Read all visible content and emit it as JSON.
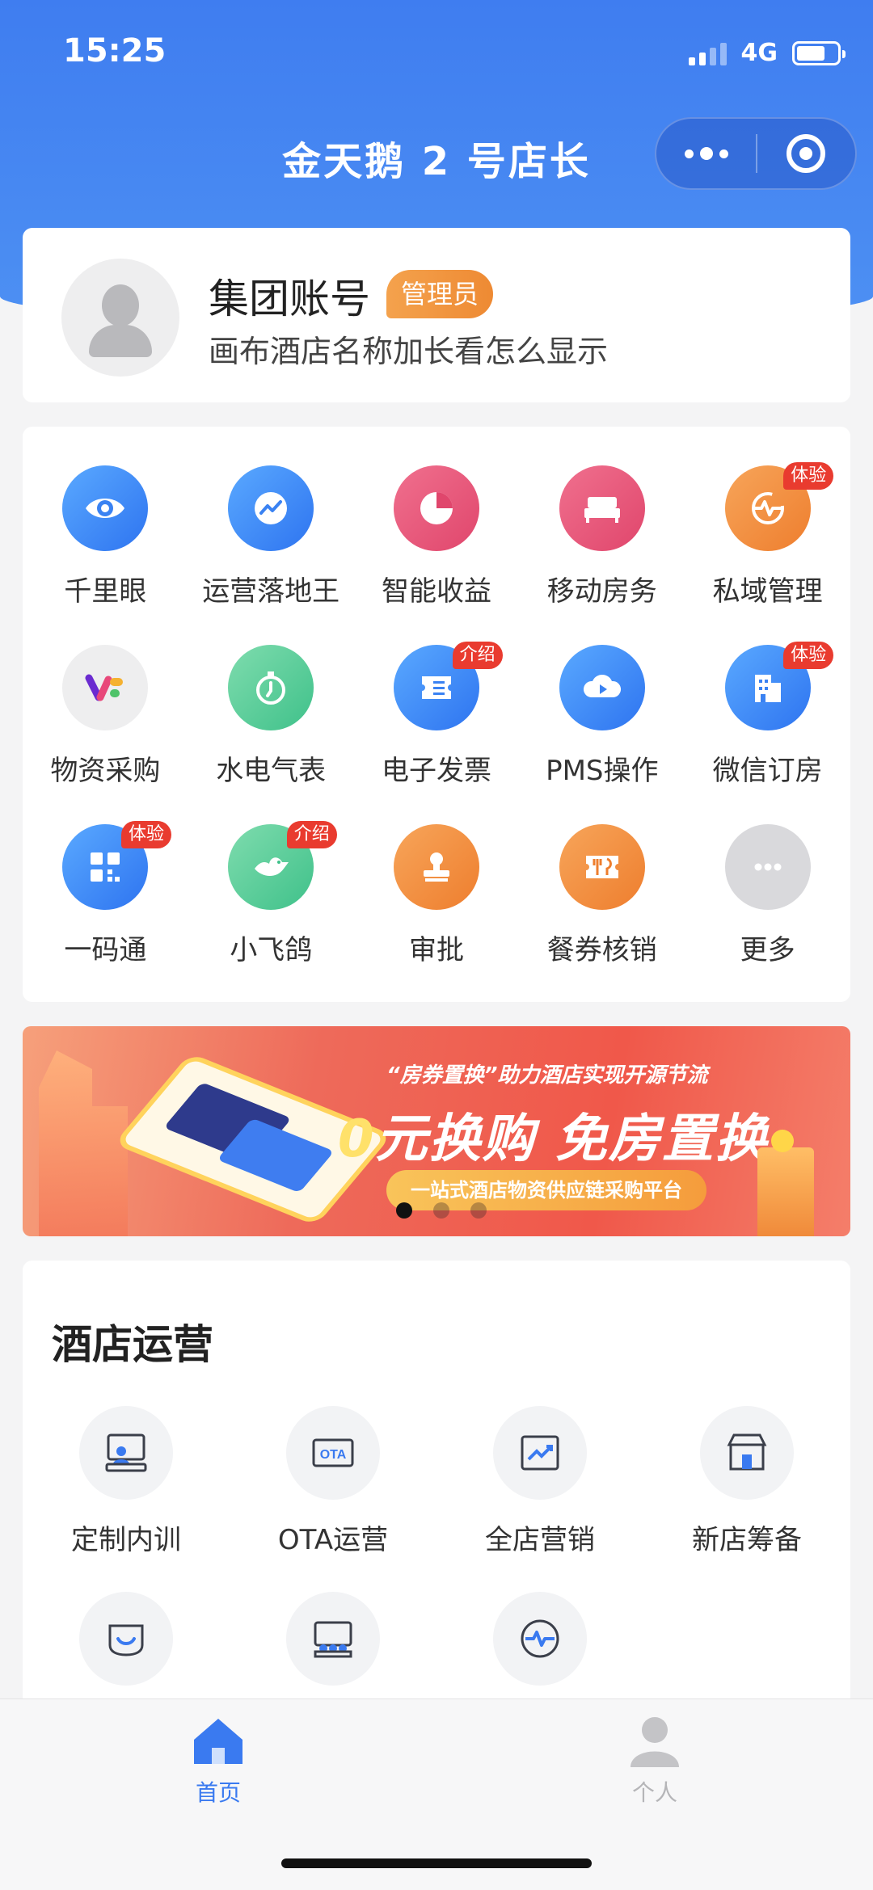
{
  "status_bar": {
    "time": "15:25",
    "network": "4G"
  },
  "nav": {
    "title": "金天鹅 2 号店长"
  },
  "profile": {
    "name": "集团账号",
    "role_badge": "管理员",
    "hotel": "画布酒店名称加长看怎么显示"
  },
  "grid": {
    "items": [
      {
        "label": "千里眼",
        "icon": "eye-icon",
        "tag": ""
      },
      {
        "label": "运营落地王",
        "icon": "trend-icon",
        "tag": ""
      },
      {
        "label": "智能收益",
        "icon": "pie-icon",
        "tag": ""
      },
      {
        "label": "移动房务",
        "icon": "bed-icon",
        "tag": ""
      },
      {
        "label": "私域管理",
        "icon": "pulse-refresh-icon",
        "tag": "体验"
      },
      {
        "label": "物资采购",
        "icon": "brand-logo-icon",
        "tag": ""
      },
      {
        "label": "水电气表",
        "icon": "stopwatch-icon",
        "tag": ""
      },
      {
        "label": "电子发票",
        "icon": "ticket-icon",
        "tag": "介绍"
      },
      {
        "label": "PMS操作",
        "icon": "cloud-play-icon",
        "tag": ""
      },
      {
        "label": "微信订房",
        "icon": "building-icon",
        "tag": "体验"
      },
      {
        "label": "一码通",
        "icon": "qr-icon",
        "tag": "体验"
      },
      {
        "label": "小飞鸽",
        "icon": "bird-icon",
        "tag": "介绍"
      },
      {
        "label": "审批",
        "icon": "stamp-icon",
        "tag": ""
      },
      {
        "label": "餐券核销",
        "icon": "meal-ticket-icon",
        "tag": ""
      },
      {
        "label": "更多",
        "icon": "more-icon",
        "tag": ""
      }
    ]
  },
  "banner": {
    "subtitle": "“房券置换”助力酒店实现开源节流",
    "headline_zero": "0",
    "headline_rest": "元换购 免房置换",
    "pill": "一站式酒店物资供应链采购平台",
    "slides": 3,
    "active_slide": 0
  },
  "ops": {
    "title": "酒店运营",
    "items": [
      {
        "label": "定制内训",
        "icon": "training-icon"
      },
      {
        "label": "OTA运营",
        "icon": "ota-icon"
      },
      {
        "label": "全店营销",
        "icon": "chart-up-icon"
      },
      {
        "label": "新店筹备",
        "icon": "store-icon"
      },
      {
        "label": "",
        "icon": "smile-chat-icon"
      },
      {
        "label": "",
        "icon": "meeting-icon"
      },
      {
        "label": "",
        "icon": "pulse-icon"
      }
    ]
  },
  "tabbar": {
    "home": "首页",
    "me": "个人"
  },
  "colors": {
    "primary": "#3f7df0",
    "badge_red": "#e93b2f",
    "admin_orange": "#ee8a33"
  }
}
